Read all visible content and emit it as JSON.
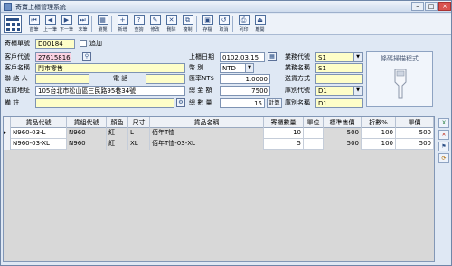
{
  "window": {
    "title": "寄賣上櫃管理系統"
  },
  "toolbar": {
    "buttons": [
      {
        "label": "首筆",
        "glyph": "⏮"
      },
      {
        "label": "上一筆",
        "glyph": "◀"
      },
      {
        "label": "下一筆",
        "glyph": "▶"
      },
      {
        "label": "末筆",
        "glyph": "⏭"
      },
      {
        "label": "瀏覽",
        "glyph": "▦"
      },
      {
        "label": "新增",
        "glyph": "+"
      },
      {
        "label": "查詢",
        "glyph": "?"
      },
      {
        "label": "修改",
        "glyph": "✎"
      },
      {
        "label": "刪除",
        "glyph": "✕"
      },
      {
        "label": "複制",
        "glyph": "⧉"
      },
      {
        "label": "存檔",
        "glyph": "▣"
      },
      {
        "label": "取消",
        "glyph": "↺"
      },
      {
        "label": "列印",
        "glyph": "⎙"
      },
      {
        "label": "離開",
        "glyph": "⏏"
      }
    ]
  },
  "form": {
    "consign_no": {
      "label": "寄櫃單號",
      "value": "D00184"
    },
    "append": {
      "label": "追加"
    },
    "customer_code": {
      "label": "客戶代號",
      "value": "27615816"
    },
    "customer_name": {
      "label": "客戶名稱",
      "value": "鬥市零售"
    },
    "contact": {
      "label": "聯 絡 人",
      "value": ""
    },
    "phone": {
      "label": "電    話",
      "value": ""
    },
    "ship_addr": {
      "label": "送貨地址",
      "value": "105台北市松山區三民路95巷34號"
    },
    "note": {
      "label": "備    註",
      "value": ""
    },
    "date": {
      "label": "上櫃日期",
      "value": "0102.03.15"
    },
    "currency": {
      "label": "幣    別",
      "value": "NTD"
    },
    "rate": {
      "label": "匯率NT$",
      "value": "1.0000"
    },
    "total_amount": {
      "label": "總 金 額",
      "value": "7500"
    },
    "total_qty": {
      "label": "總 數 量",
      "value": "15"
    },
    "calc": {
      "label": "計算"
    },
    "sales_code": {
      "label": "業務代號",
      "value": "S1"
    },
    "sales_name": {
      "label": "業務名稱",
      "value": "S1"
    },
    "ship_method": {
      "label": "送貨方式",
      "value": ""
    },
    "wh_code": {
      "label": "庫別代號",
      "value": "D1"
    },
    "wh_name": {
      "label": "庫別名稱",
      "value": "D1"
    },
    "barcode": {
      "label": "條碼掃描程式"
    }
  },
  "grid": {
    "headers": [
      "貨品代號",
      "貨組代號",
      "顏色",
      "尺寸",
      "貨品名稱",
      "寄櫃數量",
      "單位",
      "標準售價",
      "折數%",
      "單價"
    ],
    "rows": [
      [
        "N960-03-L",
        "N960",
        "紅",
        "L",
        "佰年T恤",
        "10",
        "",
        "500",
        "100",
        "500"
      ],
      [
        "N960-03-XL",
        "N960",
        "紅",
        "XL",
        "佰年T恤-03-XL",
        "5",
        "",
        "500",
        "100",
        "500"
      ]
    ]
  },
  "side_icons": [
    "excel-icon",
    "delete-row-icon",
    "flag-icon",
    "refresh-icon"
  ]
}
